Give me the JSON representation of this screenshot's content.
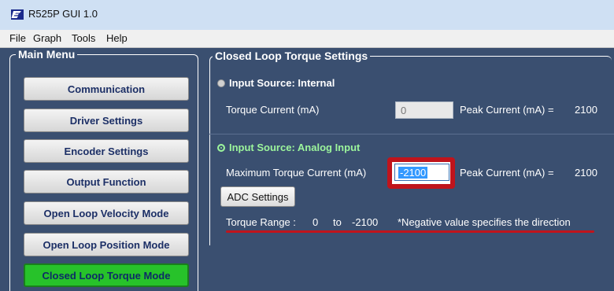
{
  "window": {
    "title": "R525P GUI 1.0"
  },
  "menubar": {
    "items": [
      "File",
      "Graph",
      "Tools",
      "Help"
    ]
  },
  "main_menu": {
    "title": "Main Menu",
    "items": [
      "Communication",
      "Driver Settings",
      "Encoder Settings",
      "Output Function",
      "Open Loop Velocity Mode",
      "Open Loop Position Mode",
      "Closed Loop Torque Mode"
    ],
    "active_item": "Closed Loop Torque Mode"
  },
  "settings": {
    "title": "Closed Loop Torque Settings",
    "internal": {
      "radio_label": "Input Source: Internal",
      "selected": false,
      "torque_label": "Torque Current (mA)",
      "torque_value": "0",
      "peak_label": "Peak Current (mA) =",
      "peak_value": "2100"
    },
    "analog": {
      "radio_label": "Input Source: Analog Input",
      "selected": true,
      "max_label": "Maximum Torque Current (mA)",
      "max_value": "-2100",
      "peak_label": "Peak Current (mA) =",
      "peak_value": "2100",
      "adc_button": "ADC Settings",
      "range_label": "Torque Range :",
      "range_from": "0",
      "range_to_word": "to",
      "range_to": "-2100",
      "range_note": "*Negative value specifies the direction"
    }
  },
  "colors": {
    "background": "#3a4f70",
    "active_button": "#27c22a",
    "selected_radio_label": "#9cf59c",
    "highlight_box": "#c0141c",
    "underline": "#c0141c"
  }
}
